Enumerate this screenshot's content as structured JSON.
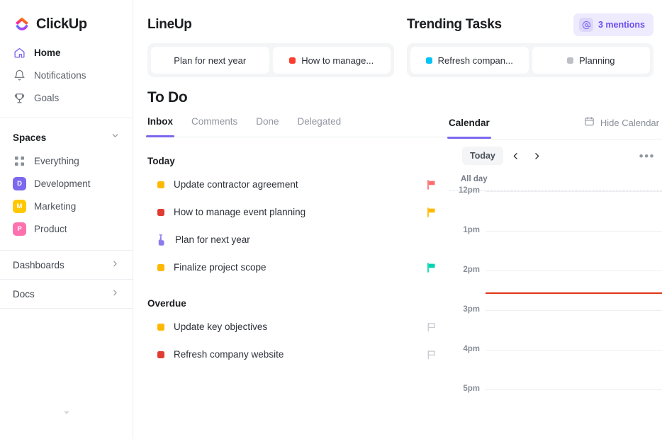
{
  "brand": {
    "name": "ClickUp",
    "accent": "#7b68ee"
  },
  "sidebar": {
    "nav": [
      {
        "label": "Home",
        "icon": "home-icon",
        "active": true
      },
      {
        "label": "Notifications",
        "icon": "bell-icon",
        "active": false
      },
      {
        "label": "Goals",
        "icon": "trophy-icon",
        "active": false
      }
    ],
    "spaces_title": "Spaces",
    "spaces": [
      {
        "label": "Everything",
        "initial": "",
        "color": "",
        "icon": "grid-icon"
      },
      {
        "label": "Development",
        "initial": "D",
        "color": "#7b68ee"
      },
      {
        "label": "Marketing",
        "initial": "M",
        "color": "#ffc800"
      },
      {
        "label": "Product",
        "initial": "P",
        "color": "#fd71af"
      }
    ],
    "footer": [
      {
        "label": "Dashboards",
        "icon": "chevron-right-icon"
      },
      {
        "label": "Docs",
        "icon": "chevron-right-icon"
      }
    ],
    "collapse_icon": "chevron-down-icon"
  },
  "lineup": {
    "title": "LineUp",
    "items": [
      {
        "label": "Plan for next year",
        "dot": ""
      },
      {
        "label": "How to manage...",
        "dot": "#f93e2e"
      }
    ]
  },
  "trending": {
    "title": "Trending Tasks",
    "mentions": {
      "label": "3 mentions",
      "icon": "at-icon"
    },
    "items": [
      {
        "label": "Refresh compan...",
        "dot": "#00c4f5"
      },
      {
        "label": "Planning",
        "dot": "#bcc0c6"
      }
    ]
  },
  "todo": {
    "title": "To Do",
    "tabs": [
      {
        "label": "Inbox",
        "active": true
      },
      {
        "label": "Comments",
        "active": false
      },
      {
        "label": "Done",
        "active": false
      },
      {
        "label": "Delegated",
        "active": false
      }
    ],
    "groups": [
      {
        "label": "Today",
        "tasks": [
          {
            "name": "Update contractor agreement",
            "dot": "#ffb800",
            "flag": "#fc6f6f",
            "flag_filled": true
          },
          {
            "name": "How to manage event planning",
            "dot": "#e13c32",
            "flag": "#ffb800",
            "flag_filled": true
          },
          {
            "name": "Plan for next year",
            "dot": "",
            "icon": "cursor-hand-icon",
            "flag": "",
            "flag_filled": false
          },
          {
            "name": "Finalize project scope",
            "dot": "#ffb800",
            "flag": "#00d4b1",
            "flag_filled": true
          }
        ]
      },
      {
        "label": "Overdue",
        "tasks": [
          {
            "name": "Update key objectives",
            "dot": "#ffb800",
            "flag": "#c9ccd2",
            "flag_filled": false
          },
          {
            "name": "Refresh company website",
            "dot": "#e13c32",
            "flag": "#c9ccd2",
            "flag_filled": false
          }
        ]
      }
    ]
  },
  "calendar": {
    "tab_label": "Calendar",
    "hide_label": "Hide Calendar",
    "hide_icon": "calendar-icon",
    "today_label": "Today",
    "prev_icon": "chevron-left-icon",
    "next_icon": "chevron-right-icon",
    "more_icon": "ellipsis-icon",
    "allday_label": "All day",
    "now_color": "#de3618",
    "now_time": "2:30pm",
    "hours": [
      "12pm",
      "1pm",
      "2pm",
      "3pm",
      "4pm",
      "5pm"
    ]
  }
}
